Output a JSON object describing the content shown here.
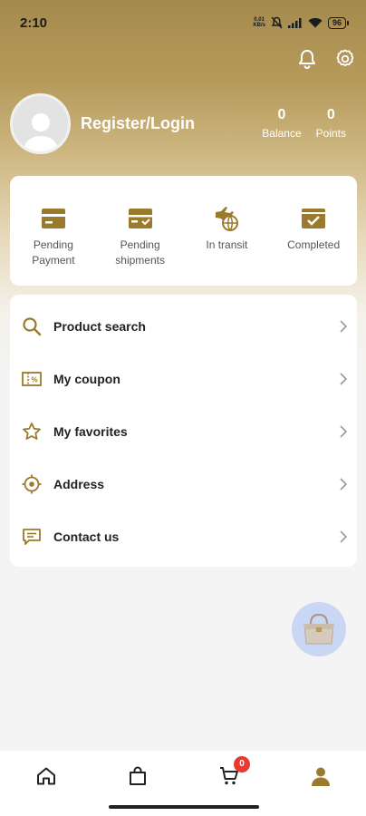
{
  "status_bar": {
    "time": "2:10",
    "net_speed_top": "0.01",
    "net_speed_bottom": "KB/s",
    "battery": "96"
  },
  "profile": {
    "register_label": "Register/Login",
    "balance_value": "0",
    "balance_label": "Balance",
    "points_value": "0",
    "points_label": "Points"
  },
  "orders": [
    {
      "line1": "Pending",
      "line2": "Payment",
      "icon": "wallet-card-icon"
    },
    {
      "line1": "Pending",
      "line2": "shipments",
      "icon": "shipment-card-icon"
    },
    {
      "line1": "In transit",
      "line2": "",
      "icon": "plane-globe-icon"
    },
    {
      "line1": "Completed",
      "line2": "",
      "icon": "check-box-icon"
    }
  ],
  "menu": [
    {
      "label": "Product search",
      "icon": "search-icon"
    },
    {
      "label": "My coupon",
      "icon": "coupon-icon"
    },
    {
      "label": "My favorites",
      "icon": "star-icon"
    },
    {
      "label": "Address",
      "icon": "location-target-icon"
    },
    {
      "label": "Contact us",
      "icon": "message-icon"
    }
  ],
  "tabbar": {
    "cart_badge": "0",
    "tabs": [
      "home-icon",
      "shopping-bag-icon",
      "cart-icon",
      "user-icon"
    ]
  },
  "colors": {
    "accent": "#9a7a2c",
    "badge": "#e83b2e",
    "float_bg": "#c9d7f5"
  }
}
